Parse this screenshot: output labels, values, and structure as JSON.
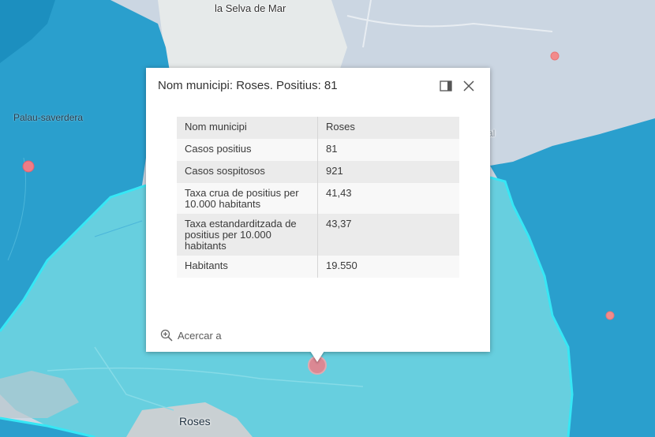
{
  "map": {
    "labels": {
      "selva": "la Selva de Mar",
      "palau": "Palau-saverdera",
      "roses": "Roses",
      "partial": "al"
    }
  },
  "popup": {
    "title": "Nom municipi: Roses. Positius: 81",
    "dock_icon": "dock-side-icon",
    "close_icon": "close-icon",
    "rows": [
      {
        "key": "Nom municipi",
        "value": "Roses"
      },
      {
        "key": "Casos positius",
        "value": "81"
      },
      {
        "key": "Casos sospitosos",
        "value": "921"
      },
      {
        "key": "Taxa crua de positius per 10.000 habitants",
        "value": "41,43"
      },
      {
        "key": "Taxa estandarditzada de positius per 10.000 habitants",
        "value": "43,37"
      },
      {
        "key": "Habitants",
        "value": "19.550"
      }
    ],
    "zoom_label": "Acercar a",
    "zoom_icon": "zoom-in-icon"
  },
  "colors": {
    "basemap": "#c9d5e2",
    "region_dark": "#2aa0cf",
    "region_light": "#66d0e0",
    "point": "#f28b8b"
  }
}
